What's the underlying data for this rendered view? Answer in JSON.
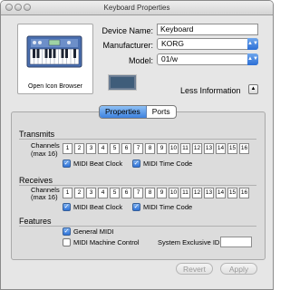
{
  "window": {
    "title": "Keyboard Properties"
  },
  "icon": {
    "caption": "Open Icon Browser"
  },
  "fields": {
    "device_name_label": "Device Name:",
    "device_name_value": "Keyboard",
    "manufacturer_label": "Manufacturer:",
    "manufacturer_value": "KORG",
    "model_label": "Model:",
    "model_value": "01/w"
  },
  "disclosure": {
    "label": "Less Information"
  },
  "tabs": [
    {
      "label": "Properties",
      "active": true
    },
    {
      "label": "Ports",
      "active": false
    }
  ],
  "transmits": {
    "title": "Transmits",
    "channels_label": "Channels",
    "channels_sub": "(max 16)",
    "channels": [
      "1",
      "2",
      "3",
      "4",
      "5",
      "6",
      "7",
      "8",
      "9",
      "10",
      "11",
      "12",
      "13",
      "14",
      "15",
      "16"
    ],
    "beat_clock": {
      "label": "MIDI Beat Clock",
      "checked": true
    },
    "time_code": {
      "label": "MIDI Time Code",
      "checked": true
    }
  },
  "receives": {
    "title": "Receives",
    "channels_label": "Channels",
    "channels_sub": "(max 16)",
    "channels": [
      "1",
      "2",
      "3",
      "4",
      "5",
      "6",
      "7",
      "8",
      "9",
      "10",
      "11",
      "12",
      "13",
      "14",
      "15",
      "16"
    ],
    "beat_clock": {
      "label": "MIDI Beat Clock",
      "checked": true
    },
    "time_code": {
      "label": "MIDI Time Code",
      "checked": true
    }
  },
  "features": {
    "title": "Features",
    "general_midi": {
      "label": "General MIDI",
      "checked": true
    },
    "machine_control": {
      "label": "MIDI Machine Control",
      "checked": false
    },
    "sysex_label": "System Exclusive ID:",
    "sysex_value": ""
  },
  "buttons": {
    "revert": "Revert",
    "apply": "Apply"
  },
  "colors": {
    "accent": "#3d82df",
    "swatch": "#3f5d7a"
  }
}
